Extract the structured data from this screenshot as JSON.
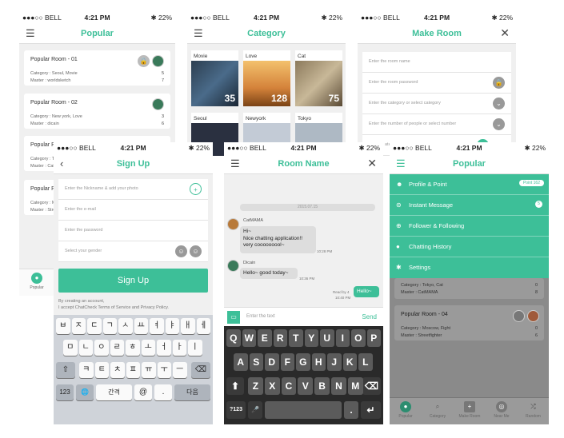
{
  "status": {
    "carrier": "●●●○○ BELL",
    "wifi": "ᯤ",
    "time": "4:21 PM",
    "battery": "✱ 22%"
  },
  "popular": {
    "title": "Popular",
    "rooms": [
      {
        "name": "Popular Room - 01",
        "category": "Category : Seoul, Movie",
        "master": "Master : worldsketch",
        "count1": "5",
        "count2": "7"
      },
      {
        "name": "Popular Room - 02",
        "category": "Category : New york, Love",
        "master": "Master : dicain",
        "count1": "3",
        "count2": "6"
      },
      {
        "name": "Popular Ro",
        "category": "Category : T",
        "master": "Master : Cat",
        "count1": "",
        "count2": ""
      },
      {
        "name": "Popular Ro",
        "category": "Category : M",
        "master": "Master : Stree",
        "count1": "",
        "count2": ""
      }
    ],
    "tab": "Popular"
  },
  "category": {
    "title": "Category",
    "tiles": [
      {
        "label": "Movie",
        "count": "35"
      },
      {
        "label": "Love",
        "count": "128"
      },
      {
        "label": "Cat",
        "count": "75"
      },
      {
        "label": "Seoul",
        "count": ""
      },
      {
        "label": "Newyork",
        "count": ""
      },
      {
        "label": "Tokyo",
        "count": ""
      }
    ]
  },
  "make_room": {
    "title": "Make Room",
    "fields": [
      "Enter the room name",
      "Enter the room password",
      "Enter the category or select category",
      "Enter the number of people or select number"
    ],
    "partial": "ate"
  },
  "signup": {
    "title": "Sign Up",
    "fields": [
      "Enter the Nickname & add your photo",
      "Enter the e-mail",
      "Enter the password",
      "Select your gender"
    ],
    "button": "Sign Up",
    "note1": "By creating an account,",
    "note2": "I accept ChatCheck Terms of Service and Privacy Policy.",
    "rows": [
      [
        "ㅂ",
        "ㅈ",
        "ㄷ",
        "ㄱ",
        "ㅅ",
        "ㅛ",
        "ㅕ",
        "ㅑ",
        "ㅐ",
        "ㅔ"
      ],
      [
        "ㅁ",
        "ㄴ",
        "ㅇ",
        "ㄹ",
        "ㅎ",
        "ㅗ",
        "ㅓ",
        "ㅏ",
        "ㅣ"
      ],
      [
        "ㅋ",
        "ㅌ",
        "ㅊ",
        "ㅍ",
        "ㅠ",
        "ㅜ",
        "ㅡ"
      ]
    ],
    "shift": "⇧",
    "del": "⌫",
    "k123": "123",
    "globe": "🌐",
    "space": "간격",
    "at": "@",
    "dot": ".",
    "done": "다음"
  },
  "chat": {
    "title": "Room Name",
    "divider": "2015.07.15",
    "msg1_name": "CatMAMA",
    "msg1_l1": "Hi~",
    "msg1_l2": "Nice chatting application!!",
    "msg1_l3": "very cooooooool~",
    "msg1_time": "10:28 PM",
    "msg2_name": "Dicain",
    "msg2": "Hello~ good today~",
    "msg2_time": "10:36 PM",
    "read": "Read by 4",
    "mine_time": "10:40 PM",
    "mine": "Hello~",
    "input": "Enter the text",
    "send": "Send",
    "rows": [
      [
        "Q",
        "W",
        "E",
        "R",
        "T",
        "Y",
        "U",
        "I",
        "O",
        "P"
      ],
      [
        "A",
        "S",
        "D",
        "F",
        "G",
        "H",
        "J",
        "K",
        "L"
      ],
      [
        "Z",
        "X",
        "C",
        "V",
        "B",
        "N",
        "M"
      ]
    ],
    "k123": "?123",
    "mic": "🎤",
    "shift": "⬆",
    "del": "⌫",
    "dot": ".",
    "ret": "↵"
  },
  "menu": {
    "title": "Popular",
    "items": [
      {
        "icon": "☻",
        "label": "Profile & Point",
        "badge": "Point 162"
      },
      {
        "icon": "⊜",
        "label": "Instant Message",
        "badge": "5"
      },
      {
        "icon": "⊕",
        "label": "Follower & Following",
        "badge": ""
      },
      {
        "icon": "●",
        "label": "Chatting History",
        "badge": ""
      },
      {
        "icon": "✱",
        "label": "Settings",
        "badge": ""
      }
    ],
    "bg_rooms": [
      {
        "name": "",
        "category": "Category : Tokyo, Cat",
        "master": "Master : CatMAMA",
        "count1": "0",
        "count2": "8"
      },
      {
        "name": "Popular Room - 04",
        "category": "Category : Moscow, Fight",
        "master": "Master : Streetfighter",
        "count1": "0",
        "count2": "6"
      }
    ],
    "tabs": [
      "Popular",
      "Category",
      "Make Room",
      "Near Me",
      "Random"
    ]
  },
  "colors": {
    "accent": "#3dbf98"
  }
}
